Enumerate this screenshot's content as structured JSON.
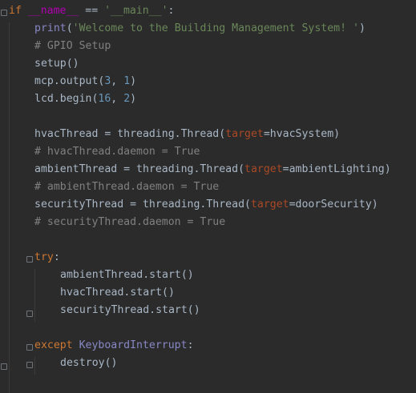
{
  "code": {
    "lines": [
      {
        "indent": 0,
        "tokens": [
          {
            "type": "kw",
            "text": "if "
          },
          {
            "type": "dunder",
            "text": "__name__"
          },
          {
            "type": "plain",
            "text": " == "
          },
          {
            "type": "str",
            "text": "'__main__'"
          },
          {
            "type": "plain",
            "text": ":"
          }
        ]
      },
      {
        "indent": 1,
        "tokens": [
          {
            "type": "bi",
            "text": "print"
          },
          {
            "type": "plain",
            "text": "("
          },
          {
            "type": "str",
            "text": "'Welcome to the Building Management System! '"
          },
          {
            "type": "plain",
            "text": ")"
          }
        ]
      },
      {
        "indent": 1,
        "tokens": [
          {
            "type": "cm",
            "text": "# GPIO Setup"
          }
        ]
      },
      {
        "indent": 1,
        "tokens": [
          {
            "type": "plain",
            "text": "setup()"
          }
        ]
      },
      {
        "indent": 1,
        "tokens": [
          {
            "type": "plain",
            "text": "mcp.output("
          },
          {
            "type": "num",
            "text": "3"
          },
          {
            "type": "plain",
            "text": ", "
          },
          {
            "type": "num",
            "text": "1"
          },
          {
            "type": "plain",
            "text": ")"
          }
        ]
      },
      {
        "indent": 1,
        "tokens": [
          {
            "type": "plain",
            "text": "lcd.begin("
          },
          {
            "type": "num",
            "text": "16"
          },
          {
            "type": "plain",
            "text": ", "
          },
          {
            "type": "num",
            "text": "2"
          },
          {
            "type": "plain",
            "text": ")"
          }
        ]
      },
      {
        "indent": 1,
        "tokens": []
      },
      {
        "indent": 1,
        "tokens": [
          {
            "type": "plain",
            "text": "hvacThread = threading.Thread("
          },
          {
            "type": "param",
            "text": "target"
          },
          {
            "type": "plain",
            "text": "=hvacSystem)"
          }
        ]
      },
      {
        "indent": 1,
        "tokens": [
          {
            "type": "cm",
            "text": "# hvacThread.daemon = True"
          }
        ]
      },
      {
        "indent": 1,
        "tokens": [
          {
            "type": "plain",
            "text": "ambientThread = threading.Thread("
          },
          {
            "type": "param",
            "text": "target"
          },
          {
            "type": "plain",
            "text": "=ambientLighting)"
          }
        ]
      },
      {
        "indent": 1,
        "tokens": [
          {
            "type": "cm",
            "text": "# ambientThread.daemon = True"
          }
        ]
      },
      {
        "indent": 1,
        "tokens": [
          {
            "type": "plain",
            "text": "securityThread = threading.Thread("
          },
          {
            "type": "param",
            "text": "target"
          },
          {
            "type": "plain",
            "text": "=doorSecurity)"
          }
        ]
      },
      {
        "indent": 1,
        "tokens": [
          {
            "type": "cm",
            "text": "# securityThread.daemon = True"
          }
        ]
      },
      {
        "indent": 1,
        "tokens": []
      },
      {
        "indent": 1,
        "tokens": [
          {
            "type": "kw",
            "text": "try"
          },
          {
            "type": "plain",
            "text": ":"
          }
        ]
      },
      {
        "indent": 2,
        "tokens": [
          {
            "type": "plain",
            "text": "ambientThread.start()"
          }
        ]
      },
      {
        "indent": 2,
        "tokens": [
          {
            "type": "plain",
            "text": "hvacThread.start()"
          }
        ]
      },
      {
        "indent": 2,
        "tokens": [
          {
            "type": "plain",
            "text": "securityThread.start()"
          }
        ]
      },
      {
        "indent": 1,
        "tokens": []
      },
      {
        "indent": 1,
        "tokens": [
          {
            "type": "kw",
            "text": "except "
          },
          {
            "type": "exc",
            "text": "KeyboardInterrupt"
          },
          {
            "type": "plain",
            "text": ":"
          }
        ]
      },
      {
        "indent": 2,
        "tokens": [
          {
            "type": "plain",
            "text": "destroy()"
          }
        ]
      }
    ]
  },
  "colors": {
    "background": "#2b2b2b",
    "text": "#a9b7c6",
    "keyword": "#cc7832",
    "builtin": "#8888c6",
    "string": "#6a8759",
    "comment": "#808080",
    "number": "#6897bb",
    "parameter": "#aa4926",
    "dunder": "#b200b2"
  }
}
